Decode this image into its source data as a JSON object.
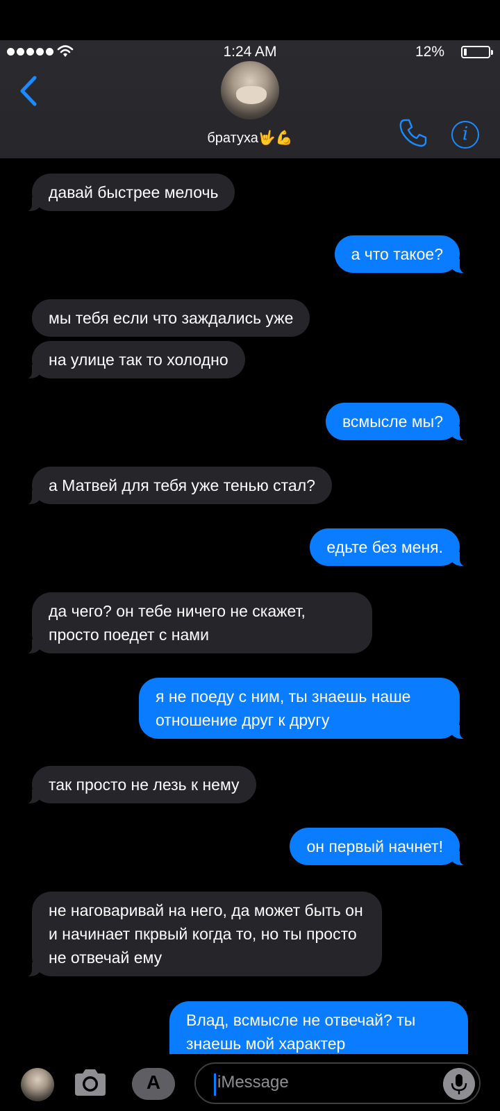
{
  "status_bar": {
    "time": "1:24 AM",
    "battery": "12%"
  },
  "header": {
    "contact_name": "братуха",
    "contact_emojis": "🤟💪"
  },
  "messages": [
    {
      "side": "in",
      "text": "давай быстрее мелочь"
    },
    {
      "side": "out",
      "text": "а что такое?"
    },
    {
      "side": "in",
      "text": "мы тебя если что заждались уже"
    },
    {
      "side": "in",
      "text": "на улице так то холодно"
    },
    {
      "side": "out",
      "text": "всмысле мы?"
    },
    {
      "side": "in",
      "text": "а Матвей для тебя уже тенью стал?"
    },
    {
      "side": "out",
      "text": "едьте без меня."
    },
    {
      "side": "in",
      "text": "да чего? он тебе ничего не скажет, просто поедет с нами"
    },
    {
      "side": "out",
      "text": "я не поеду с ним, ты знаешь наше отношение друг к другу"
    },
    {
      "side": "in",
      "text": "так просто не лезь к нему"
    },
    {
      "side": "out",
      "text": "он первый начнет!"
    },
    {
      "side": "in",
      "text": "не наговаривай на него, да может быть он и начинает пкрвый когда то, но ты просто не отвечай ему"
    },
    {
      "side": "out",
      "text": "Влад, всмысле не отвечай? ты знаешь мой характер"
    }
  ],
  "composer": {
    "placeholder": "iMessage"
  },
  "colors": {
    "outgoing": "#0a7cff",
    "incoming": "#26252a",
    "accent": "#1a8cff"
  },
  "icons": [
    "back-chevron-icon",
    "phone-icon",
    "info-icon",
    "camera-icon",
    "app-store-icon",
    "microphone-icon",
    "wifi-icon",
    "battery-icon"
  ]
}
